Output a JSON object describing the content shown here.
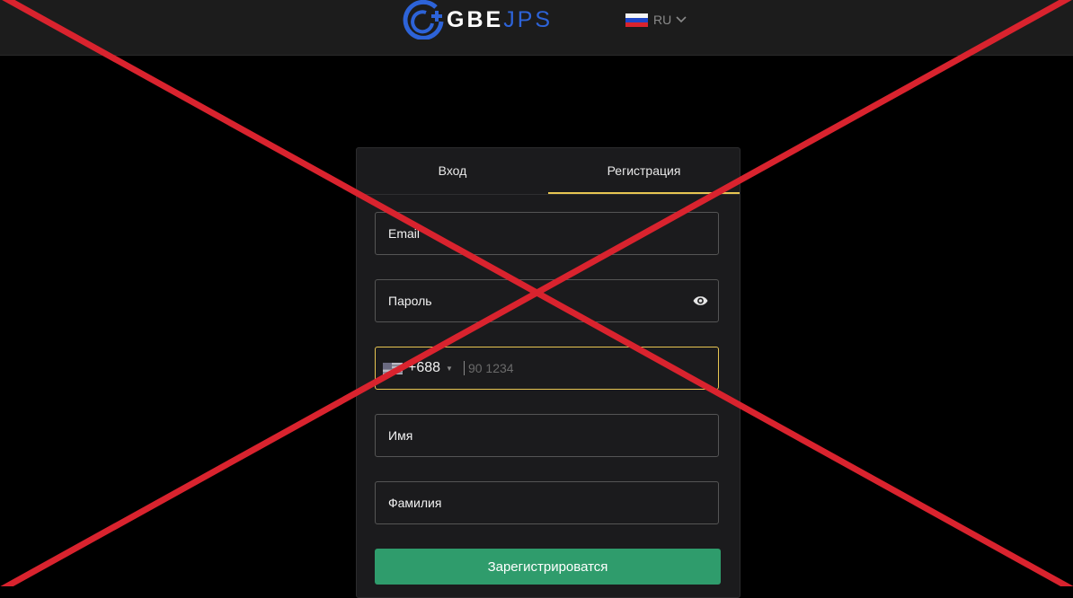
{
  "header": {
    "logo_bold": "GBE",
    "logo_thin": "JPS",
    "language": {
      "label": "RU",
      "flag_icon": "russia-flag-icon"
    }
  },
  "auth": {
    "tabs": [
      {
        "label": "Вход",
        "active": false
      },
      {
        "label": "Регистрация",
        "active": true
      }
    ],
    "fields": {
      "email_label": "Email",
      "password_label": "Пароль",
      "phone_code": "+688",
      "phone_placeholder": "90 1234",
      "phone_value": "",
      "first_name_label": "Имя",
      "last_name_label": "Фамилия"
    },
    "submit_label": "Зарегистрироватся"
  },
  "colors": {
    "accent_yellow": "#e8c652",
    "submit_green": "#2f9c6c",
    "logo_blue": "#2d63d8",
    "cross_red": "#d9232e"
  }
}
